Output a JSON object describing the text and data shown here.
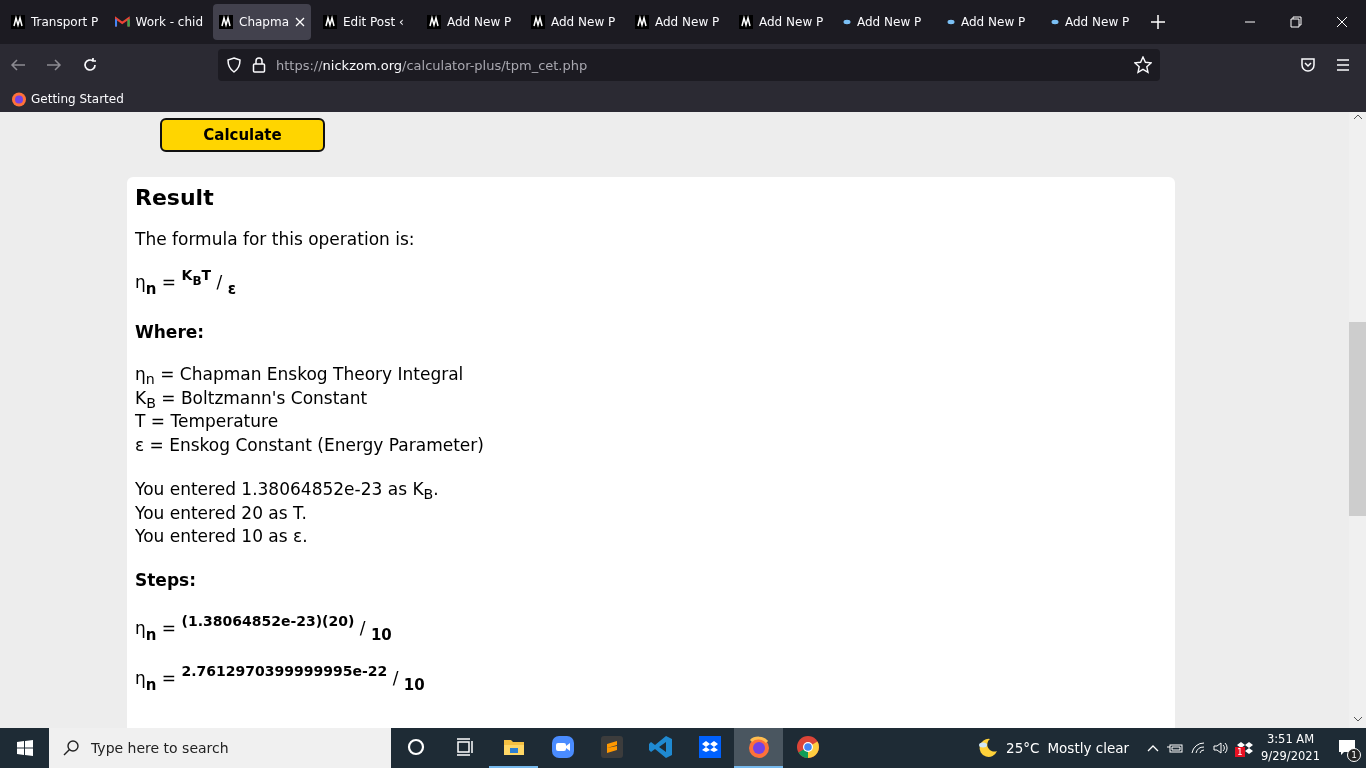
{
  "browser": {
    "tabs": [
      {
        "title": "Transport P",
        "kind": "site",
        "selected": false
      },
      {
        "title": "Work - chid",
        "kind": "mail",
        "selected": false
      },
      {
        "title": "Chapma",
        "kind": "site",
        "selected": true
      },
      {
        "title": "Edit Post ‹",
        "kind": "site",
        "selected": false
      },
      {
        "title": "Add New P",
        "kind": "site",
        "selected": false
      },
      {
        "title": "Add New P",
        "kind": "site",
        "selected": false
      },
      {
        "title": "Add New P",
        "kind": "site",
        "selected": false
      },
      {
        "title": "Add New P",
        "kind": "site",
        "selected": false
      },
      {
        "title": "Add New P",
        "kind": "dot",
        "selected": false
      },
      {
        "title": "Add New P",
        "kind": "dot",
        "selected": false
      },
      {
        "title": "Add New P",
        "kind": "dot",
        "selected": false
      }
    ],
    "url": {
      "scheme": "https://",
      "host": "nickzom.org",
      "path": "/calculator-plus/tpm_cet.php"
    },
    "bookmarks": [
      "Getting Started"
    ]
  },
  "page": {
    "calculate_button": "Calculate",
    "result": {
      "title": "Result",
      "intro": "The formula for this operation is:",
      "formula": "η$_{n}$ = $^{K}$$_{B}$$^{T}$ / $_{ε}$",
      "where_label": "Where:",
      "definitions": [
        "η$_{n}$ = Chapman Enskog Theory Integral",
        "K$_{B}$ = Boltzmann's Constant",
        "T = Temperature",
        "ε = Enskog Constant (Energy Parameter)"
      ],
      "entered": [
        "You entered 1.38064852e-23 as K$_{B}$.",
        "You entered 20 as T.",
        "You entered 10 as ε."
      ],
      "steps_label": "Steps:",
      "steps": [
        "η$_{n}$ = $^{(1.38064852e-23)(20)}$ / $_{10}$",
        "η$_{n}$ = $^{2.7612970399999995e-22}$ / $_{10}$"
      ]
    }
  },
  "taskbar": {
    "search_placeholder": "Type here to search",
    "apps": [
      {
        "kind": "cortana",
        "running": false,
        "selected": false
      },
      {
        "kind": "taskview",
        "running": false,
        "selected": false
      },
      {
        "kind": "explorer",
        "running": true,
        "selected": false
      },
      {
        "kind": "zoom",
        "running": false,
        "selected": false
      },
      {
        "kind": "sublime",
        "running": false,
        "selected": false
      },
      {
        "kind": "vscode",
        "running": false,
        "selected": false
      },
      {
        "kind": "dropbox",
        "running": false,
        "selected": false
      },
      {
        "kind": "firefox",
        "running": true,
        "selected": true
      },
      {
        "kind": "chrome",
        "running": false,
        "selected": false
      }
    ],
    "weather": {
      "temperature": "25°C",
      "condition": "Mostly clear"
    },
    "time": "3:51 AM",
    "date": "9/29/2021",
    "dropbox_badge": "1",
    "notification_count": "1"
  }
}
